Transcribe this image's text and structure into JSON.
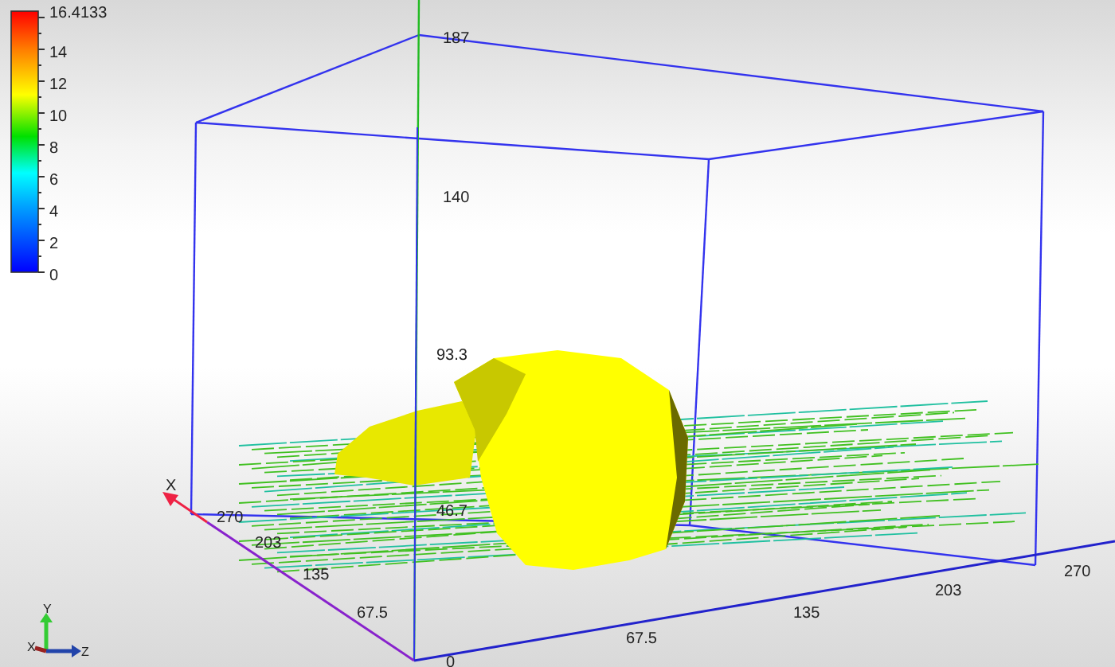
{
  "color_scale": {
    "labels": [
      "16.4133",
      "14",
      "12",
      "10",
      "8",
      "6",
      "4",
      "2",
      "0"
    ]
  },
  "y_axis": {
    "ticks": [
      "187",
      "140",
      "93.3",
      "46.7"
    ]
  },
  "x_axis": {
    "name": "X",
    "ticks": [
      "270",
      "203",
      "135",
      "67.5"
    ]
  },
  "z_axis": {
    "ticks": [
      "0",
      "67.5",
      "135",
      "203",
      "270"
    ]
  },
  "orientation_triad": {
    "x": "X",
    "y": "Y",
    "z": "Z"
  }
}
